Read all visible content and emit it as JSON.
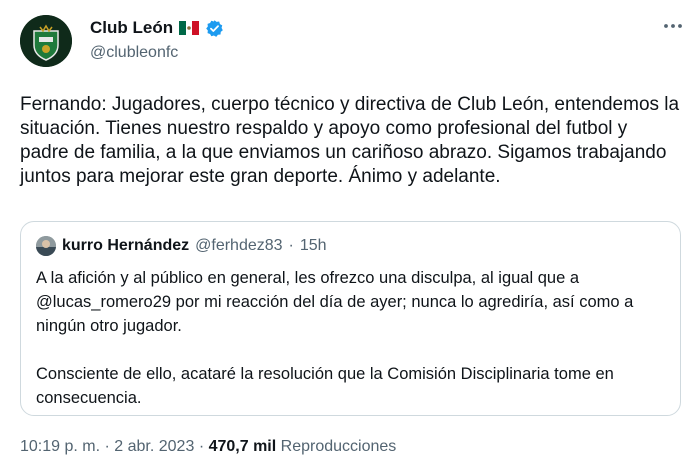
{
  "author": {
    "name": "Club León",
    "handle": "@clubleonfc",
    "avatar_icon": "club-leon-logo",
    "flag_icon": "mexico-flag-icon",
    "verified_icon": "verified-badge-icon",
    "verified_color": "#1d9bf0"
  },
  "more_icon": "more-horizontal-icon",
  "tweet": {
    "text": "Fernando: Jugadores, cuerpo técnico y directiva de Club León, entendemos la situación. Tienes nuestro respaldo y apoyo como profesional del futbol y padre de familia, a la que enviamos un cariñoso abrazo. Sigamos trabajando juntos para mejorar este gran deporte. Ánimo y adelante."
  },
  "quoted": {
    "name": "kurro Hernández",
    "handle": "@ferhdez83",
    "separator": "·",
    "time": "15h",
    "paragraphs": [
      "A la afición y al público en general, les ofrezco una disculpa, al igual que a @lucas_romero29 por mi reacción del día de ayer; nunca lo agrediría, así como a ningún otro jugador.",
      "Consciente de ello, acataré la resolución que la Comisión Disciplinaria tome en consecuencia."
    ]
  },
  "footer": {
    "time": "10:19 p. m.",
    "separator": "·",
    "date": "2 abr. 2023",
    "separator2": "·",
    "views_count": "470,7 mil",
    "views_label": "Reproducciones"
  }
}
